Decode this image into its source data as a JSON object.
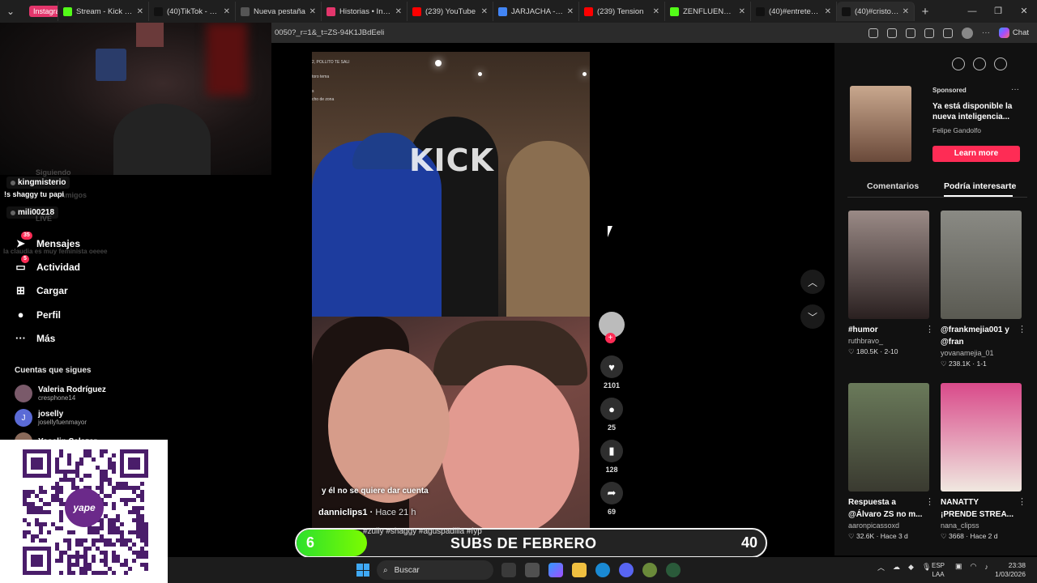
{
  "browser": {
    "tabs": [
      {
        "label": "Instagram",
        "pill": true,
        "fav": "#e3366c",
        "w": 46
      },
      {
        "label": "Stream - Kick Dash",
        "fav": "#53fc18",
        "w": 112
      },
      {
        "label": "(40)TikTok - Make Y",
        "fav": "#111111",
        "w": 107
      },
      {
        "label": "Nueva pestaña",
        "fav": "#555555",
        "w": 106
      },
      {
        "label": "Historias • Instagra",
        "fav": "#e3366c",
        "w": 106
      },
      {
        "label": "(239) YouTube",
        "fav": "#ff0000",
        "w": 106
      },
      {
        "label": "JARJACHA - Búsqu",
        "fav": "#4285f4",
        "w": 106
      },
      {
        "label": "(239) Tension",
        "fav": "#ff0000",
        "w": 106
      },
      {
        "label": "ZENFLUENCER Stre",
        "fav": "#53fc18",
        "w": 106
      },
      {
        "label": "(40)#entretenimien",
        "fav": "#111111",
        "w": 106
      },
      {
        "label": "(40)#cristorata",
        "fav": "#111111",
        "w": 96,
        "active": true
      }
    ],
    "url": "0050?_r=1&_t=ZS-94K1JBdEeli",
    "chat_label": "Chat"
  },
  "chat": {
    "partial_top": "Siguiendo",
    "user1": "kingmisterio",
    "msg1": "!s shaggy tu papi",
    "msg1_faded": "Amigos",
    "user2": "mili00218",
    "live_faded": "LIVE",
    "msg3_faded": "la claudia es muy feminista oeeee"
  },
  "nav": {
    "items": [
      {
        "label": "Mensajes",
        "icon": "paper-plane-icon",
        "glyph": "➤",
        "badge": "35"
      },
      {
        "label": "Actividad",
        "icon": "inbox-icon",
        "glyph": "▭",
        "badge": "5"
      },
      {
        "label": "Cargar",
        "icon": "upload-icon",
        "glyph": "⊞"
      },
      {
        "label": "Perfil",
        "icon": "profile-icon",
        "glyph": "●"
      },
      {
        "label": "Más",
        "icon": "more-icon",
        "glyph": "···"
      }
    ],
    "following_title": "Cuentas que sigues",
    "following": [
      {
        "name": "Valeria Rodríguez",
        "handle": "cresphone14",
        "initial": "",
        "color": "#7a5a6a"
      },
      {
        "name": "joselly",
        "handle": "josellyfuenmayor",
        "initial": "J",
        "color": "#5b6bd6"
      },
      {
        "name": "Yoselin Salazar",
        "handle": "",
        "initial": "",
        "color": "#8a6a5a"
      }
    ]
  },
  "qr": {
    "logo": "yape"
  },
  "video": {
    "caption": "y él no se quiere dar cuenta",
    "author": "danniclips1",
    "time": "Hace 21 h",
    "watermark": "KICK",
    "hashtags": "#zully #shaggy #aguspadilla #fyp",
    "overlay_top": "2, POLLITO TE SALI",
    "overlay_2": "toro tema",
    "overlay_3": "s",
    "overlay_4": "cho de zona"
  },
  "actions": {
    "likes": "2101",
    "comments": "25",
    "saves": "128",
    "shares": "69"
  },
  "ad": {
    "sponsored": "Sponsored",
    "title": "Ya está disponible la nueva inteligencia...",
    "brand": "Felipe Gandolfo",
    "cta": "Learn more"
  },
  "panel_tabs": {
    "comments": "Comentarios",
    "related": "Podría interesarte"
  },
  "cards": [
    {
      "title": "#humor",
      "author": "ruthbravo_",
      "likes": "180.5K",
      "date": "2-10",
      "bg": "linear-gradient(180deg,#9a8a86,#2a2020)"
    },
    {
      "title": "@frankmejia001 y @fran",
      "author": "yovanamejia_01",
      "likes": "238.1K",
      "date": "1-1",
      "bg": "linear-gradient(180deg,#8a8a84,#5a5a52)"
    },
    {
      "title": "Respuesta a @Álvaro ZS no m...",
      "author": "aaronpicassoxd",
      "likes": "32.6K",
      "date": "Hace 3 d",
      "bg": "linear-gradient(180deg,#6a7a5a,#3a3a30)"
    },
    {
      "title": "NANATTY ¡PRENDE STREA...",
      "author": "nana_clipss",
      "likes": "3668",
      "date": "Hace 2 d",
      "bg": "linear-gradient(180deg,#d94a8a,#f0e8e0)"
    }
  ],
  "subs": {
    "current": "6",
    "label": "SUBS DE FEBRERO",
    "goal": "40",
    "progress": 0.15
  },
  "taskbar": {
    "search": "Buscar",
    "lang1": "ESP",
    "lang2": "LAA",
    "time": "23:38",
    "date": "1/03/2026"
  }
}
